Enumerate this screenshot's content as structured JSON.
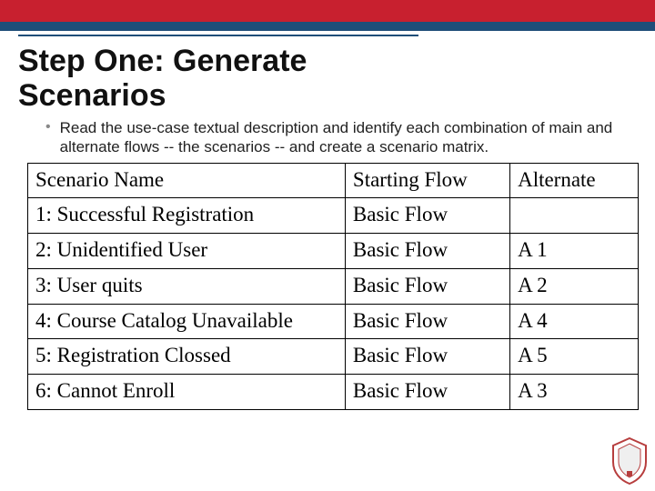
{
  "title_line1": "Step One: Generate",
  "title_line2": "Scenarios",
  "bullet_text": "Read the use-case textual description and identify each combination of main and alternate flows -- the scenarios -- and create a scenario matrix.",
  "headers": {
    "col1": "Scenario Name",
    "col2": "Starting Flow",
    "col3": "Alternate"
  },
  "chart_data": {
    "type": "table",
    "columns": [
      "Scenario Name",
      "Starting Flow",
      "Alternate"
    ],
    "rows": [
      {
        "name": "1: Successful Registration",
        "starting": "Basic Flow",
        "alternate": ""
      },
      {
        "name": "2: Unidentified User",
        "starting": "Basic Flow",
        "alternate": "A 1"
      },
      {
        "name": "3: User quits",
        "starting": "Basic Flow",
        "alternate": "A 2"
      },
      {
        "name": "4: Course Catalog Unavailable",
        "starting": "Basic Flow",
        "alternate": "A 4"
      },
      {
        "name": "5: Registration Clossed",
        "starting": "Basic Flow",
        "alternate": "A 5"
      },
      {
        "name": "6: Cannot Enroll",
        "starting": "Basic Flow",
        "alternate": "A 3"
      }
    ]
  }
}
